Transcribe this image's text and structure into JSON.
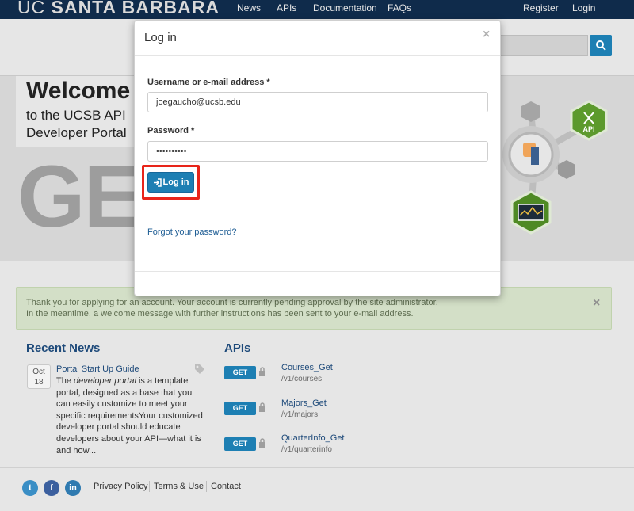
{
  "navbar": {
    "brand_prefix": "UC",
    "brand_main": "SANTA BARBARA",
    "links": [
      "News",
      "APIs",
      "Documentation",
      "FAQs"
    ],
    "register": "Register",
    "login": "Login"
  },
  "hero": {
    "title": "Welcome",
    "subtitle": "to the UCSB API Developer Portal",
    "big_text": "GE",
    "api_badge": "API"
  },
  "alert": {
    "line1": "Thank you for applying for an account. Your account is currently pending approval by the site administrator.",
    "line2": "In the meantime, a welcome message with further instructions has been sent to your e-mail address.",
    "close": "×"
  },
  "news": {
    "heading": "Recent News",
    "date_month": "Oct",
    "date_day": "18",
    "item_title": "Portal Start Up Guide",
    "item_body_pre": "The ",
    "item_body_em": "developer portal",
    "item_body_post": " is a template portal, designed as a base that you can easily customize to meet your specific requirementsYour customized developer portal should educate developers about your API—what it is and how..."
  },
  "apis": {
    "heading": "APIs",
    "items": [
      {
        "method": "GET",
        "name": "Courses_Get",
        "path": "/v1/courses"
      },
      {
        "method": "GET",
        "name": "Majors_Get",
        "path": "/v1/majors"
      },
      {
        "method": "GET",
        "name": "QuarterInfo_Get",
        "path": "/v1/quarterinfo"
      }
    ]
  },
  "footer": {
    "social": [
      "t",
      "f",
      "in"
    ],
    "links": [
      "Privacy Policy",
      "Terms & Use",
      "Contact"
    ]
  },
  "modal": {
    "title": "Log in",
    "close": "×",
    "username_label": "Username or e-mail address *",
    "username_value": "joegaucho@ucsb.edu",
    "password_label": "Password *",
    "password_value": "••••••••••",
    "login_button": "Log in",
    "forgot_link": "Forgot your password?"
  },
  "colors": {
    "navbar": "#0f2b4b",
    "accent": "#1d7fb3",
    "highlight": "#e8251a",
    "alert_bg": "#d3dfc7",
    "link": "#1e4a7a"
  }
}
